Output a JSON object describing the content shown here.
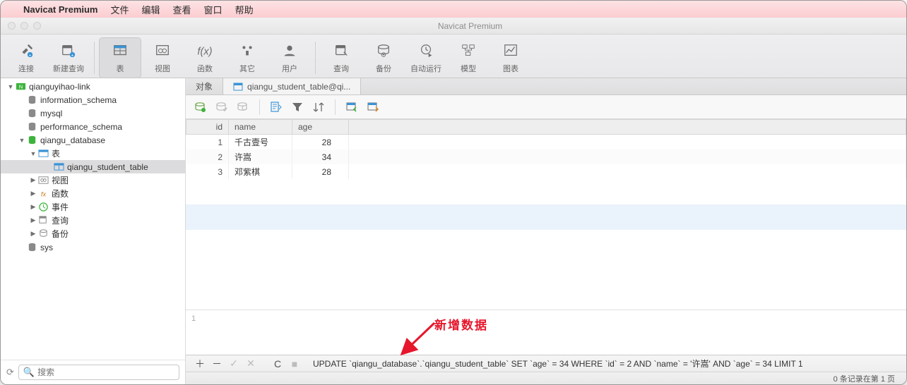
{
  "menubar": {
    "appname": "Navicat Premium",
    "items": [
      "文件",
      "编辑",
      "查看",
      "窗口",
      "帮助"
    ]
  },
  "window": {
    "title": "Navicat Premium"
  },
  "toolbar": {
    "buttons": [
      {
        "id": "connect",
        "label": "连接"
      },
      {
        "id": "new-query",
        "label": "新建查询"
      },
      {
        "id": "table",
        "label": "表"
      },
      {
        "id": "view",
        "label": "视图"
      },
      {
        "id": "function",
        "label": "函数"
      },
      {
        "id": "other",
        "label": "其它"
      },
      {
        "id": "user",
        "label": "用户"
      },
      {
        "id": "query",
        "label": "查询"
      },
      {
        "id": "backup",
        "label": "备份"
      },
      {
        "id": "auto",
        "label": "自动运行"
      },
      {
        "id": "model",
        "label": "模型"
      },
      {
        "id": "chart",
        "label": "图表"
      }
    ]
  },
  "sidebar": {
    "connection": "qianguyihao-link",
    "schemas": [
      "information_schema",
      "mysql",
      "performance_schema"
    ],
    "database": "qiangu_database",
    "db_children": {
      "tables": "表",
      "table_item": "qiangu_student_table",
      "views": "视图",
      "functions": "函数",
      "events": "事件",
      "queries": "查询",
      "backups": "备份"
    },
    "sys": "sys",
    "search_placeholder": "搜索"
  },
  "tabs": {
    "object": "对象",
    "table_tab": "qiangu_student_table@qi..."
  },
  "grid": {
    "columns": [
      "id",
      "name",
      "age"
    ],
    "rows": [
      {
        "id": "1",
        "name": "千古壹号",
        "age": "28"
      },
      {
        "id": "2",
        "name": "许嵩",
        "age": "34"
      },
      {
        "id": "3",
        "name": "邓紫棋",
        "age": "28"
      }
    ]
  },
  "annotation": {
    "text": "新增数据",
    "lineno": "1"
  },
  "actionbar": {
    "sql": "UPDATE `qiangu_database`.`qiangu_student_table` SET `age` = 34 WHERE `id` = 2 AND `name` = '许嵩' AND `age` = 34 LIMIT 1"
  },
  "statusbar": {
    "text": "0 条记录在第 1 页"
  }
}
